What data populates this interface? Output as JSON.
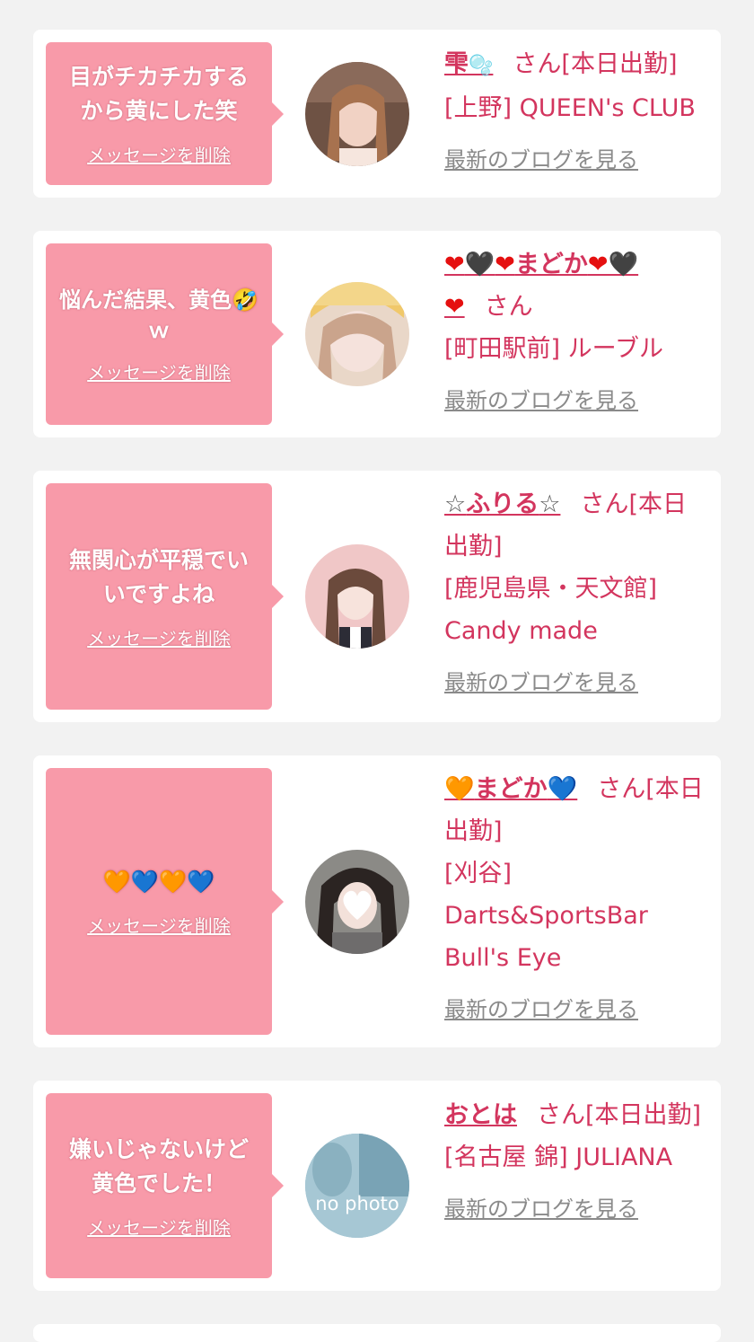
{
  "delete_label": "メッセージを削除",
  "blog_label": "最新のブログを見る",
  "san_suffix": "さん",
  "cards": [
    {
      "message": "目がチカチカする\nから黄にした笑",
      "name": "雫🫧",
      "status": "[本日出勤]",
      "store": "[上野] QUEEN's CLUB"
    },
    {
      "message": "悩んだ結果、黄色🤣ｗ",
      "name": "❤🖤❤まどか❤🖤❤",
      "status": "",
      "store": "[町田駅前] ルーブル"
    },
    {
      "message": "無関心が平穏でい\nいですよね",
      "name": "☆ふりる☆",
      "status": "[本日出勤]",
      "store": "[鹿児島県・天文館] Candy made"
    },
    {
      "message": "🧡💙🧡💙",
      "name": "🧡まどか💙",
      "status": "[本日出勤]",
      "store": "[刈谷] Darts&SportsBar Bull's Eye"
    },
    {
      "message": "嫌いじゃないけど\n黄色でした！",
      "name": "おとは",
      "status": "[本日出勤]",
      "store": "[名古屋 錦] JULIANA"
    }
  ],
  "no_photo_text": "no photo",
  "colors": {
    "accent": "#d3355e",
    "bubble": "#f89aa9",
    "link_gray": "#8a8a8a",
    "bg": "#f2f2f2"
  }
}
